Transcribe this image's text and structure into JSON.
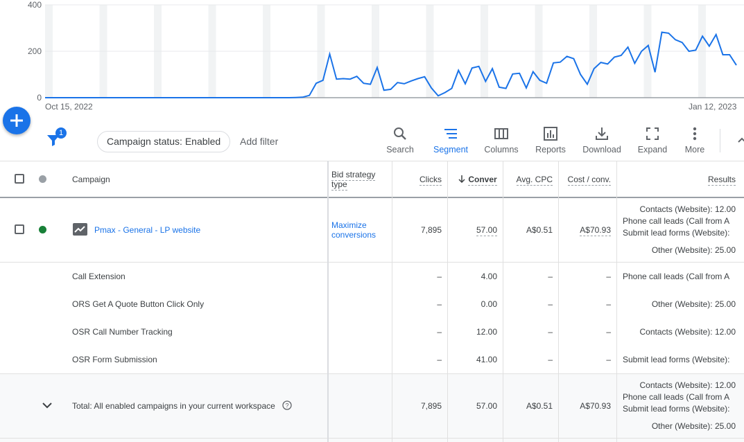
{
  "chart": {
    "y_ticks": [
      "400",
      "200",
      "0"
    ],
    "x_start_label": "Oct 15, 2022",
    "x_end_label": "Jan 12, 2023",
    "line_color": "#1a73e8"
  },
  "chart_data": {
    "type": "line",
    "ylim": [
      0,
      400
    ],
    "values": [
      0,
      0,
      0,
      0,
      0,
      0,
      0,
      0,
      0,
      0,
      0,
      0,
      0,
      0,
      0,
      0,
      0,
      0,
      0,
      0,
      0,
      0,
      0,
      0,
      0,
      0,
      0,
      0,
      0,
      0,
      0,
      0,
      0,
      0,
      0,
      0,
      0,
      1,
      2,
      10,
      62,
      75,
      188,
      80,
      82,
      80,
      92,
      62,
      58,
      130,
      32,
      36,
      65,
      60,
      72,
      82,
      90,
      42,
      8,
      22,
      40,
      118,
      60,
      128,
      135,
      70,
      125,
      45,
      40,
      102,
      105,
      42,
      112,
      75,
      62,
      150,
      153,
      178,
      168,
      100,
      58,
      125,
      152,
      145,
      175,
      182,
      218,
      148,
      200,
      225,
      110,
      282,
      278,
      250,
      238,
      200,
      205,
      265,
      222,
      272,
      185,
      185,
      140
    ]
  },
  "fab": {
    "icon": "plus-icon"
  },
  "toolbar": {
    "filter_badge": "1",
    "status_chip": "Campaign status: Enabled",
    "add_filter": "Add filter",
    "tools": [
      {
        "label": "Search",
        "icon": "search-icon"
      },
      {
        "label": "Segment",
        "icon": "segment-icon"
      },
      {
        "label": "Columns",
        "icon": "columns-icon"
      },
      {
        "label": "Reports",
        "icon": "reports-icon"
      },
      {
        "label": "Download",
        "icon": "download-icon"
      },
      {
        "label": "Expand",
        "icon": "expand-icon"
      },
      {
        "label": "More",
        "icon": "more-vert-icon"
      }
    ]
  },
  "table": {
    "headers": {
      "campaign": "Campaign",
      "bid_strategy": "Bid strategy type",
      "clicks": "Clicks",
      "conversions": "Conver",
      "avg_cpc": "Avg. CPC",
      "cost_conv": "Cost / conv.",
      "results": "Results"
    },
    "campaign_row": {
      "status_color": "#188038",
      "name": "Pmax - General - LP website",
      "bid_strategy": "Maximize conversions",
      "clicks": "7,895",
      "conversions": "57.00",
      "avg_cpc": "A$0.51",
      "cost_conv": "A$70.93",
      "results": [
        "Contacts (Website): 12.00",
        "Phone call leads (Call from A",
        "Submit lead forms (Website):",
        "Other (Website): 25.00"
      ]
    },
    "sub_rows": [
      {
        "name": "Call Extension",
        "clicks": "–",
        "conversions": "4.00",
        "avg_cpc": "–",
        "cost_conv": "–",
        "results": "Phone call leads (Call from A"
      },
      {
        "name": "ORS Get A Quote Button Click Only",
        "clicks": "–",
        "conversions": "0.00",
        "avg_cpc": "–",
        "cost_conv": "–",
        "results": "Other (Website): 25.00"
      },
      {
        "name": "OSR Call Number Tracking",
        "clicks": "–",
        "conversions": "12.00",
        "avg_cpc": "–",
        "cost_conv": "–",
        "results": "Contacts (Website): 12.00"
      },
      {
        "name": "OSR Form Submission",
        "clicks": "–",
        "conversions": "41.00",
        "avg_cpc": "–",
        "cost_conv": "–",
        "results": "Submit lead forms (Website):"
      }
    ],
    "total_row": {
      "label": "Total: All enabled campaigns in your current workspace",
      "clicks": "7,895",
      "conversions": "57.00",
      "avg_cpc": "A$0.51",
      "cost_conv": "A$70.93",
      "results": [
        "Contacts (Website): 12.00",
        "Phone call leads (Call from A",
        "Submit lead forms (Website):",
        "Other (Website): 25.00"
      ]
    }
  }
}
